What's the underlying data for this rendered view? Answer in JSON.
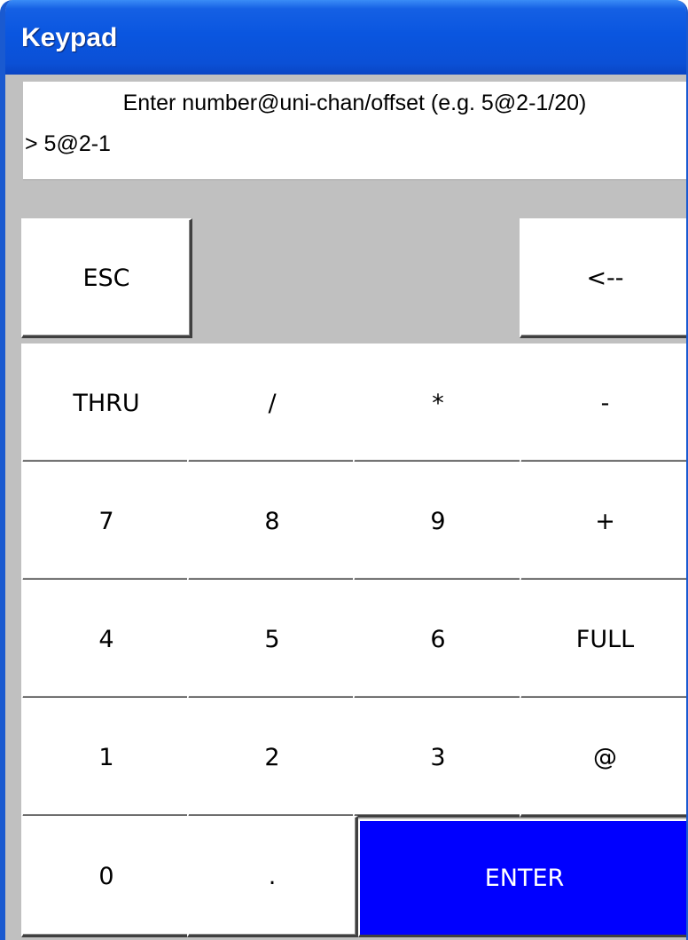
{
  "window": {
    "title": "Keypad"
  },
  "display": {
    "prompt": "Enter number@uni-chan/offset  (e.g. 5@2-1/20)",
    "entry": "> 5@2-1"
  },
  "keys": {
    "esc": "ESC",
    "backspace": "<--",
    "thru": "THRU",
    "slash": "/",
    "multiply": "*",
    "minus": "-",
    "seven": "7",
    "eight": "8",
    "nine": "9",
    "plus": "+",
    "four": "4",
    "five": "5",
    "six": "6",
    "full": "FULL",
    "one": "1",
    "two": "2",
    "three": "3",
    "at": "@",
    "zero": "0",
    "dot": ".",
    "enter": "ENTER"
  },
  "colors": {
    "titlebar": "#0a56e0",
    "enter_key": "#0000ff",
    "panel": "#c0c0c0"
  }
}
